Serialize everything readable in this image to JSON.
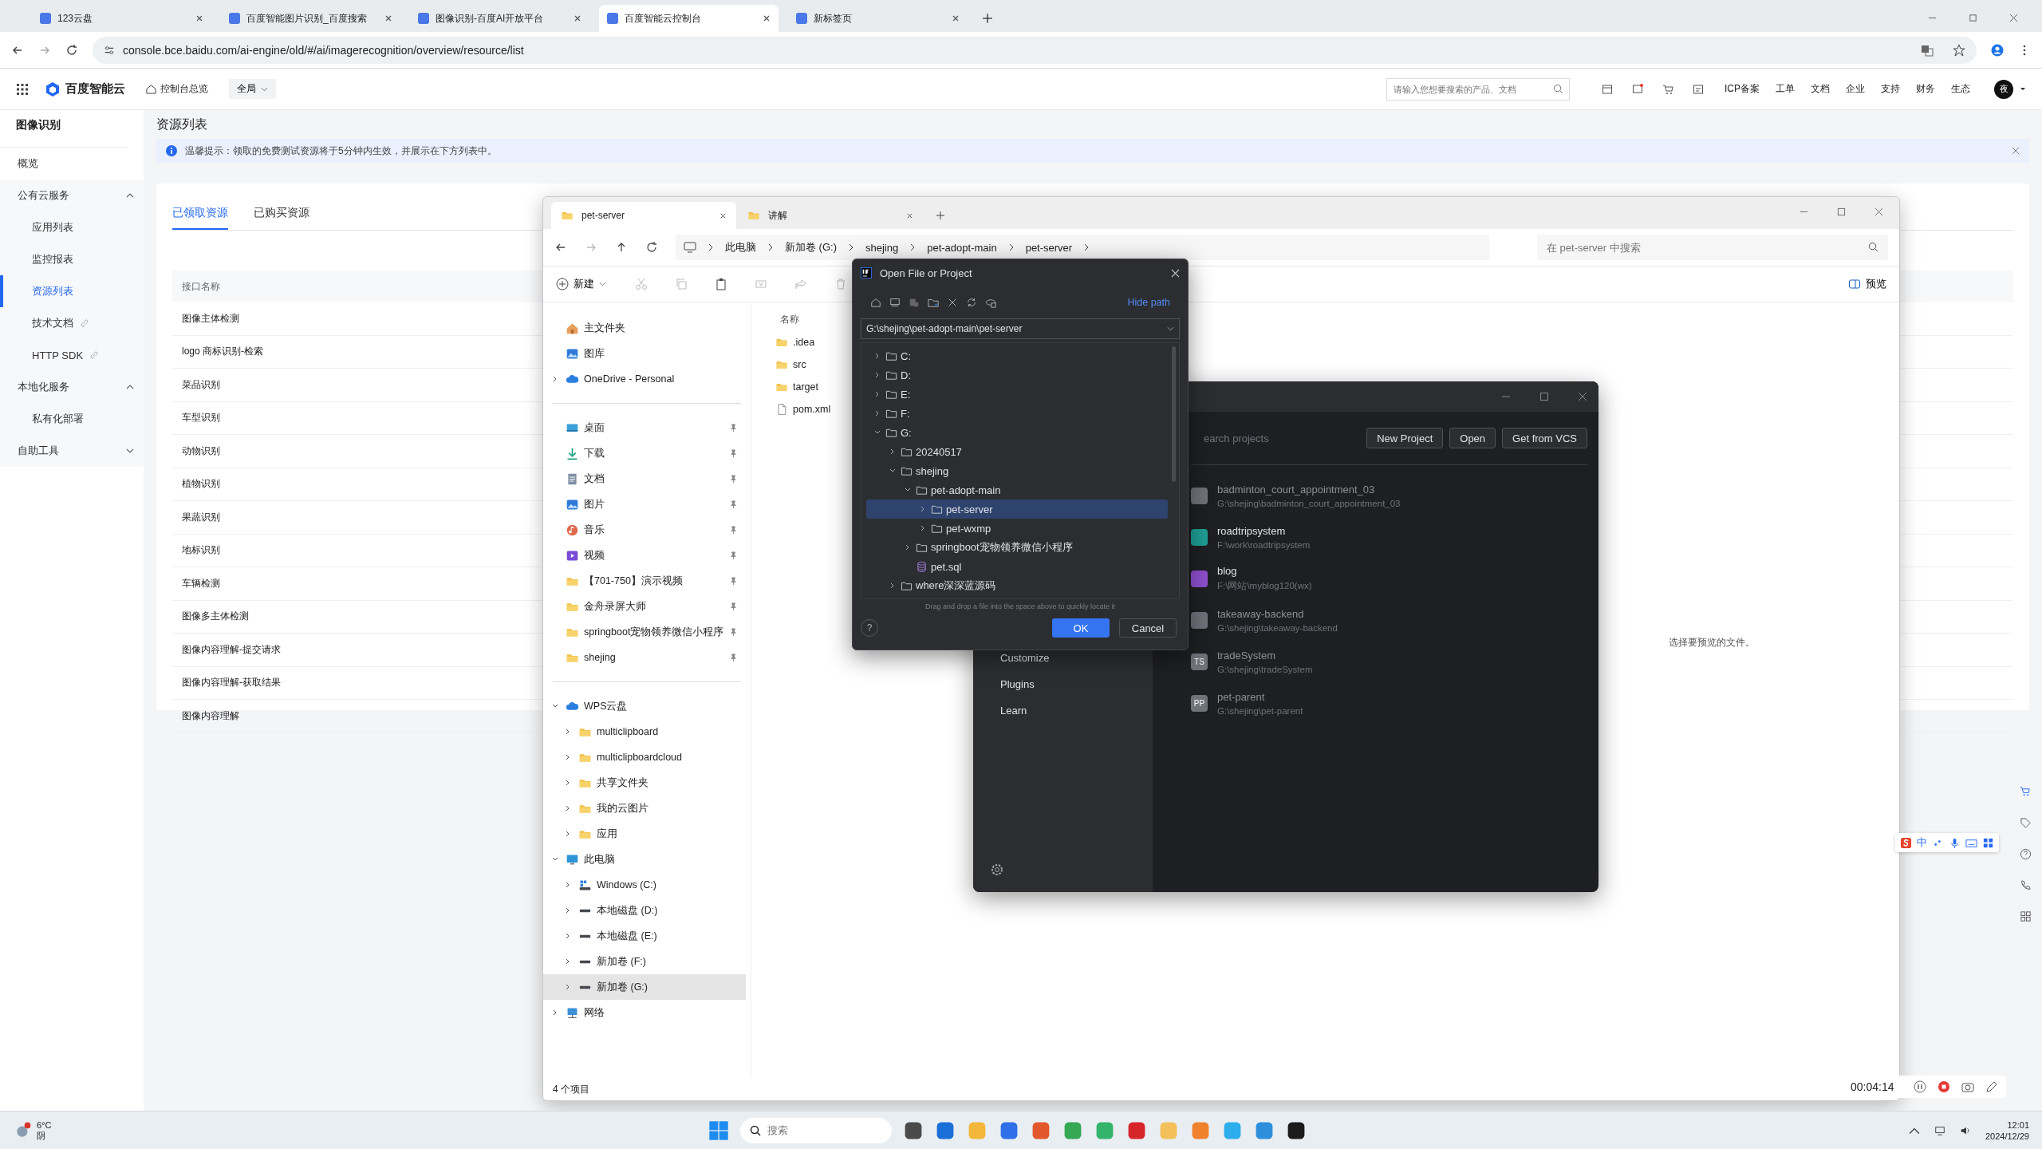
{
  "browser": {
    "tabs": [
      {
        "title": "123云盘",
        "selected": false
      },
      {
        "title": "百度智能图片识别_百度搜索",
        "selected": false
      },
      {
        "title": "图像识别-百度AI开放平台",
        "selected": false
      },
      {
        "title": "百度智能云控制台",
        "selected": true
      },
      {
        "title": "新标签页",
        "selected": false
      }
    ],
    "url": "console.bce.baidu.com/ai-engine/old/#/ai/imagerecognition/overview/resource/list"
  },
  "console_header": {
    "logo": "百度智能云",
    "overview": "控制台总览",
    "region": "全局",
    "search": {
      "placeholder": "请输入您想要搜索的产品、文档"
    },
    "links": [
      "ICP备案",
      "工单",
      "文档",
      "企业",
      "支持",
      "财务",
      "生态"
    ],
    "avatar": "夜"
  },
  "sidebar": {
    "title": "图像识别",
    "items": [
      {
        "label": "概览",
        "selected": false
      },
      {
        "label": "公有云服务",
        "expanded": true,
        "children": [
          {
            "label": "应用列表",
            "selected": false,
            "link": false
          },
          {
            "label": "监控报表",
            "selected": false,
            "link": false
          },
          {
            "label": "资源列表",
            "selected": true,
            "link": false
          },
          {
            "label": "技术文档",
            "selected": false,
            "link": true
          },
          {
            "label": "HTTP SDK",
            "selected": false,
            "link": true
          }
        ]
      },
      {
        "label": "本地化服务",
        "expanded": true,
        "children": [
          {
            "label": "私有化部署",
            "selected": false,
            "link": false
          }
        ]
      },
      {
        "label": "自助工具",
        "expanded": false
      }
    ]
  },
  "main": {
    "title": "资源列表",
    "notice": "温馨提示：领取的免费测试资源将于5分钟内生效，并展示在下方列表中。",
    "tabs": [
      {
        "label": "已领取资源",
        "selected": true
      },
      {
        "label": "已购买资源",
        "selected": false
      }
    ],
    "table": {
      "columns": [
        "接口名称"
      ],
      "rows": [
        "图像主体检测",
        "logo 商标识别-检索",
        "菜品识别",
        "车型识别",
        "动物识别",
        "植物识别",
        "果蔬识别",
        "地标识别",
        "车辆检测",
        "图像多主体检测",
        "图像内容理解-提交请求",
        "图像内容理解-获取结果",
        "图像内容理解"
      ]
    }
  },
  "explorer": {
    "tabs": [
      {
        "title": "pet-server",
        "selected": true
      },
      {
        "title": "讲解",
        "selected": false
      }
    ],
    "breadcrumb": [
      "此电脑",
      "新加卷 (G:)",
      "shejing",
      "pet-adopt-main",
      "pet-server"
    ],
    "search": {
      "placeholder": "在 pet-server 中搜索"
    },
    "new_button": "新建",
    "preview_button": "预览",
    "nav": [
      {
        "items": [
          {
            "label": "主文件夹",
            "kind": "home",
            "selected": false
          },
          {
            "label": "图库",
            "kind": "gallery",
            "selected": false
          },
          {
            "label": "OneDrive - Personal",
            "kind": "cloud",
            "expanded": false,
            "selected": false
          }
        ]
      },
      {
        "items": [
          {
            "label": "桌面",
            "kind": "desktop",
            "pinned": true,
            "selected": false
          },
          {
            "label": "下载",
            "kind": "download",
            "pinned": true,
            "selected": false
          },
          {
            "label": "文档",
            "kind": "doc",
            "pinned": true,
            "selected": false
          },
          {
            "label": "图片",
            "kind": "gallery",
            "pinned": true,
            "selected": false
          },
          {
            "label": "音乐",
            "kind": "music",
            "pinned": true,
            "selected": false
          },
          {
            "label": "视频",
            "kind": "video",
            "pinned": true,
            "selected": false
          },
          {
            "label": "【701-750】演示视频",
            "kind": "folder",
            "pinned": true,
            "selected": false
          },
          {
            "label": "金舟录屏大师",
            "kind": "folder",
            "pinned": true,
            "selected": false
          },
          {
            "label": "springboot宠物领养微信小程序",
            "kind": "folder",
            "pinned": true,
            "selected": false
          },
          {
            "label": "shejing",
            "kind": "folder",
            "pinned": true,
            "selected": false
          }
        ]
      },
      {
        "items": [
          {
            "label": "WPS云盘",
            "kind": "cloud",
            "expanded": true,
            "selected": false,
            "children": [
              {
                "label": "multiclipboard",
                "kind": "folder",
                "expanded": false,
                "selected": false
              },
              {
                "label": "multiclipboardcloud",
                "kind": "folder",
                "expanded": false,
                "selected": false
              },
              {
                "label": "共享文件夹",
                "kind": "folder",
                "expanded": false,
                "selected": false
              },
              {
                "label": "我的云图片",
                "kind": "folder",
                "expanded": false,
                "selected": false
              },
              {
                "label": "应用",
                "kind": "folder",
                "expanded": false,
                "selected": false
              }
            ]
          },
          {
            "label": "此电脑",
            "kind": "pc",
            "expanded": true,
            "selected": false,
            "children": [
              {
                "label": "Windows (C:)",
                "kind": "windrive",
                "expanded": false,
                "selected": false
              },
              {
                "label": "本地磁盘 (D:)",
                "kind": "drive",
                "expanded": false,
                "selected": false
              },
              {
                "label": "本地磁盘 (E:)",
                "kind": "drive",
                "expanded": false,
                "selected": false
              },
              {
                "label": "新加卷 (F:)",
                "kind": "drive",
                "expanded": false,
                "selected": false
              },
              {
                "label": "新加卷 (G:)",
                "kind": "drive",
                "expanded": false,
                "selected": true
              }
            ]
          },
          {
            "label": "网络",
            "kind": "network",
            "expanded": false,
            "selected": false
          }
        ]
      }
    ],
    "column": "名称",
    "files": [
      {
        "name": ".idea",
        "kind": "folder"
      },
      {
        "name": "src",
        "kind": "folder"
      },
      {
        "name": "target",
        "kind": "folder"
      },
      {
        "name": "pom.xml",
        "kind": "file"
      }
    ],
    "preview_hint": "选择要预览的文件。",
    "status": "4 个项目"
  },
  "ide": {
    "menu": [
      "Customize",
      "Plugins",
      "Learn"
    ],
    "search": {
      "placeholder": "earch projects"
    },
    "buttons": [
      "New Project",
      "Open",
      "Get from VCS"
    ],
    "projects": [
      {
        "name": "badminton_court_appointment_03",
        "path": "G:\\shejing\\badminton_court_appointment_03",
        "color": "#6f737a",
        "dimmed": true
      },
      {
        "name": "roadtripsystem",
        "path": "F:\\work\\roadtripsystem",
        "color": "#1f9e94",
        "dimmed": false
      },
      {
        "name": "blog",
        "path": "F:\\网站\\myblog120(wx)",
        "color": "#8f4fd0",
        "dimmed": false
      },
      {
        "name": "takeaway-backend",
        "path": "G:\\shejing\\takeaway-backend",
        "color": "#6f737a",
        "dimmed": true
      },
      {
        "name": "tradeSystem",
        "path": "G:\\shejing\\tradeSystem",
        "badge": "TS",
        "color": "#6f737a",
        "dimmed": true
      },
      {
        "name": "pet-parent",
        "path": "G:\\shejing\\pet-parent",
        "badge": "PP",
        "color": "#6f737a",
        "dimmed": true
      }
    ]
  },
  "dialog": {
    "title": "Open File or Project",
    "hide_path": "Hide path",
    "path": "G:\\shejing\\pet-adopt-main\\pet-server",
    "tree": [
      {
        "name": "C:",
        "kind": "folder",
        "expanded": false,
        "selected": false
      },
      {
        "name": "D:",
        "kind": "folder",
        "expanded": false,
        "selected": false
      },
      {
        "name": "E:",
        "kind": "folder",
        "expanded": false,
        "selected": false
      },
      {
        "name": "F:",
        "kind": "folder",
        "expanded": false,
        "selected": false
      },
      {
        "name": "G:",
        "kind": "folder",
        "expanded": true,
        "selected": false,
        "children": [
          {
            "name": "20240517",
            "kind": "folder",
            "expanded": false,
            "selected": false
          },
          {
            "name": "shejing",
            "kind": "folder",
            "expanded": true,
            "selected": false,
            "children": [
              {
                "name": "pet-adopt-main",
                "kind": "folder",
                "expanded": true,
                "selected": false,
                "children": [
                  {
                    "name": "pet-server",
                    "kind": "folder",
                    "expanded": false,
                    "selected": true
                  },
                  {
                    "name": "pet-wxmp",
                    "kind": "folder",
                    "expanded": false,
                    "selected": false
                  }
                ]
              },
              {
                "name": "springboot宠物领养微信小程序",
                "kind": "folder",
                "expanded": false,
                "selected": false
              },
              {
                "name": "pet.sql",
                "kind": "file",
                "selected": false
              }
            ]
          },
          {
            "name": "where深深蓝源码",
            "kind": "folder",
            "expanded": false,
            "selected": false
          }
        ]
      }
    ],
    "hint": "Drag and drop a file into the space above to quickly locate it",
    "help": "?",
    "ok": "OK",
    "cancel": "Cancel"
  },
  "recorder": {
    "time": "00:04:14"
  },
  "ime": {
    "mode": "中"
  },
  "taskbar": {
    "weather": {
      "temp": "6°C",
      "desc": "阴"
    },
    "search": {
      "placeholder": "搜索"
    },
    "time": "12:01",
    "date": "2024/12/29"
  }
}
